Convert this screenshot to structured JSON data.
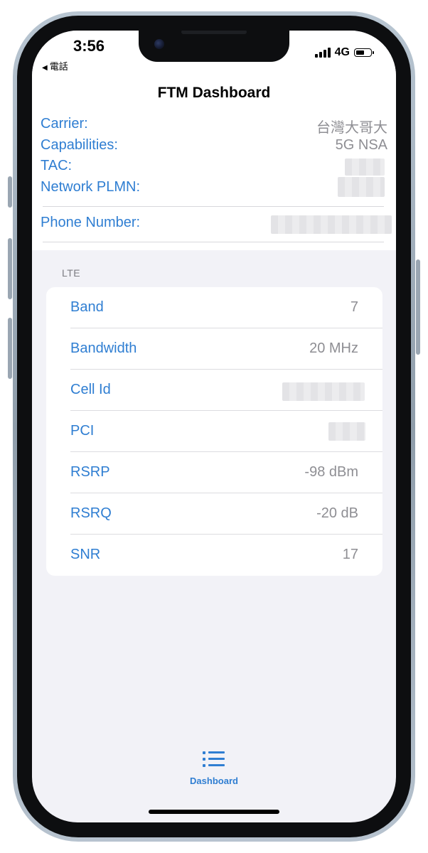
{
  "status_bar": {
    "time": "3:56",
    "back_app": "電話",
    "network": "4G"
  },
  "nav": {
    "title": "FTM Dashboard"
  },
  "info": {
    "carrier_label": "Carrier:",
    "carrier_value": "台灣大哥大",
    "capabilities_label": "Capabilities:",
    "capabilities_value": "5G NSA",
    "tac_label": "TAC:",
    "plmn_label": "Network PLMN:",
    "phone_label": "Phone Number:"
  },
  "lte": {
    "header": "LTE",
    "rows": [
      {
        "label": "Band",
        "value": "7"
      },
      {
        "label": "Bandwidth",
        "value": "20 MHz"
      },
      {
        "label": "Cell Id",
        "value": ""
      },
      {
        "label": "PCI",
        "value": ""
      },
      {
        "label": "RSRP",
        "value": "-98 dBm"
      },
      {
        "label": "RSRQ",
        "value": "-20 dB"
      },
      {
        "label": "SNR",
        "value": "17"
      }
    ]
  },
  "tab_bar": {
    "items": [
      {
        "label": "Dashboard",
        "icon": "list-icon",
        "selected": true
      }
    ],
    "accent_color": "#2f7ed2"
  },
  "colors": {
    "link_blue": "#2f7ed2",
    "value_gray": "#8e8e93",
    "grouped_background": "#f2f2f7"
  }
}
